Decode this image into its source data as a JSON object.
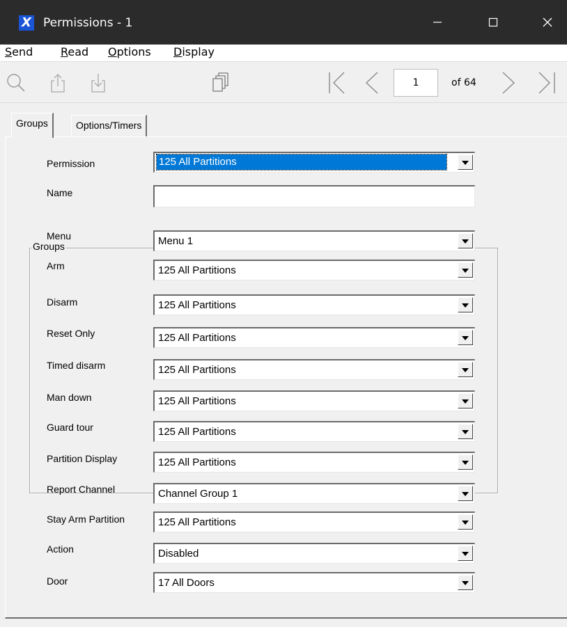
{
  "window": {
    "title": "Permissions - 1",
    "icon": "app-x-icon",
    "controls": [
      "minimize-icon",
      "maximize-icon",
      "close-icon"
    ]
  },
  "menu": {
    "items": [
      {
        "label": "Send",
        "underline": "S",
        "rest": "end"
      },
      {
        "label": "Read",
        "underline": "R",
        "rest": "ead"
      },
      {
        "label": "Options",
        "underline": "O",
        "rest": "ptions"
      },
      {
        "label": "Display",
        "underline": "D",
        "rest": "isplay"
      }
    ]
  },
  "toolbar": {
    "icons": [
      "search-icon",
      "upload-icon",
      "download-icon",
      "copy-icon",
      "first-page-icon",
      "previous-page-icon",
      "next-page-icon",
      "last-page-icon"
    ],
    "page_value": "1",
    "page_total": "of 64"
  },
  "tabs": [
    {
      "label": "Groups",
      "active": true
    },
    {
      "label": "Options/Timers",
      "active": false
    }
  ],
  "form": {
    "permission": {
      "label": "Permission",
      "value": "125 All Partitions"
    },
    "name": {
      "label": "Name",
      "value": ""
    },
    "menu": {
      "label": "Menu",
      "value": "Menu 1"
    },
    "groups_title": "Groups",
    "groups": [
      {
        "label": "Arm",
        "value": "125 All Partitions"
      },
      {
        "label": "Disarm",
        "value": "125 All Partitions"
      },
      {
        "label": "Reset Only",
        "value": "125 All Partitions"
      },
      {
        "label": "Timed disarm",
        "value": "125 All Partitions"
      },
      {
        "label": "Man down",
        "value": "125 All Partitions"
      },
      {
        "label": "Guard tour",
        "value": "125 All Partitions"
      },
      {
        "label": "Partition Display",
        "value": "125 All Partitions"
      },
      {
        "label": "Report Channel",
        "value": "Channel Group 1"
      },
      {
        "label": "Stay Arm Partition",
        "value": "125 All Partitions"
      },
      {
        "label": "Action",
        "value": "Disabled"
      },
      {
        "label": "Door",
        "value": "17 All Doors"
      }
    ]
  },
  "colors": {
    "titlebar": "#2b2b2b",
    "selection": "#0078d7",
    "app_icon": "#1a55d6",
    "window_bg": "#f0f0f0"
  }
}
